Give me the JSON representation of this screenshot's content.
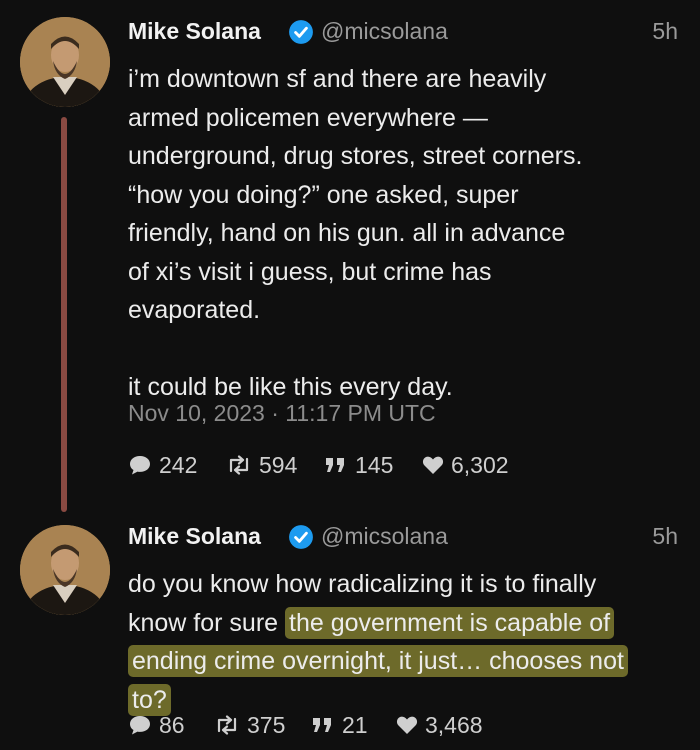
{
  "colors": {
    "background": "#0f0f0f",
    "verified": "#1d9bf0",
    "highlight": "#6d6a2a",
    "thread_line": "#8a4a42"
  },
  "tweets": [
    {
      "author": {
        "name": "Mike Solana",
        "handle": "@micsolana"
      },
      "time_ago": "5h",
      "lines": [
        "i’m downtown sf and there are heavily",
        "armed policemen everywhere —",
        "underground, drug stores, street corners.",
        "“how you doing?” one asked, super",
        "friendly, hand on his gun. all in advance",
        "of xi’s visit i guess, but crime has",
        "evaporated.",
        "",
        "it could be like this every day."
      ],
      "timestamp": "Nov 10, 2023 · 11:17 PM UTC",
      "stats": {
        "replies": "242",
        "retweets": "594",
        "quotes": "145",
        "likes": "6,302"
      }
    },
    {
      "author": {
        "name": "Mike Solana",
        "handle": "@micsolana"
      },
      "time_ago": "5h",
      "line1": "do you know how radicalizing it is to finally",
      "line2_plain": "know for sure ",
      "line2_hl": "the government is capable of",
      "line3_hl": "ending crime overnight, it just… chooses not",
      "line4_hl": "to?",
      "stats": {
        "replies": "86",
        "retweets": "375",
        "quotes": "21",
        "likes": "3,468"
      }
    }
  ]
}
